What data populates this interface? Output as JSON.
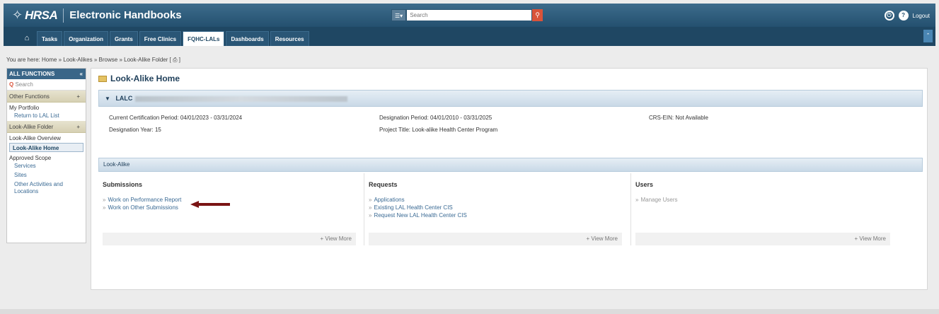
{
  "app": {
    "logo": "HRSA",
    "title": "Electronic Handbooks",
    "search_dd": "☰▾",
    "search_placeholder": "Search",
    "logout": "Logout"
  },
  "nav": {
    "tabs": [
      "Tasks",
      "Organization",
      "Grants",
      "Free Clinics",
      "FQHC-LALs",
      "Dashboards",
      "Resources"
    ],
    "active": "FQHC-LALs"
  },
  "breadcrumb": {
    "prefix": "You are here:",
    "items": [
      "Home",
      "Look-Alikes",
      "Browse",
      "Look-Alike Folder"
    ],
    "separator": "»",
    "suffix": "[ ⎙ ]"
  },
  "sidebar": {
    "header": "ALL FUNCTIONS",
    "collapse": "«",
    "search_placeholder": "Search",
    "sections": [
      {
        "label": "Other Functions",
        "toggle": "+"
      },
      {
        "label": "Look-Alike Folder",
        "toggle": "+"
      }
    ],
    "my_portfolio": "My Portfolio",
    "return_link": "Return to LAL List",
    "overview": "Look-Alike Overview",
    "active_item": "Look-Alike Home",
    "approved_scope": "Approved Scope",
    "scope_links": [
      "Services",
      "Sites",
      "Other Activities and Locations"
    ]
  },
  "main": {
    "title": "Look-Alike Home",
    "entity_prefix": "LALC",
    "info": {
      "cert_period": "Current Certification Period: 04/01/2023 - 03/31/2024",
      "designation_year": "Designation Year: 15",
      "designation_period": "Designation Period: 04/01/2010 - 03/31/2025",
      "project_title": "Project Title: Look-alike Health Center Program",
      "crs_ein": "CRS-EIN: Not Available"
    },
    "section_header": "Look-Alike",
    "columns": [
      {
        "title": "Submissions",
        "items": [
          "Work on Performance Report",
          "Work on Other Submissions"
        ],
        "view_more": "+ View More"
      },
      {
        "title": "Requests",
        "items": [
          "Applications",
          "Existing LAL Health Center CIS",
          "Request New LAL Health Center CIS"
        ],
        "view_more": "+ View More"
      },
      {
        "title": "Users",
        "items": [
          "Manage Users"
        ],
        "view_more": "+ View More"
      }
    ]
  },
  "colors": {
    "topbar": "#24506f",
    "navbar": "#1f4763",
    "arrow": "#7a1414",
    "accent_orange": "#d9533a"
  }
}
